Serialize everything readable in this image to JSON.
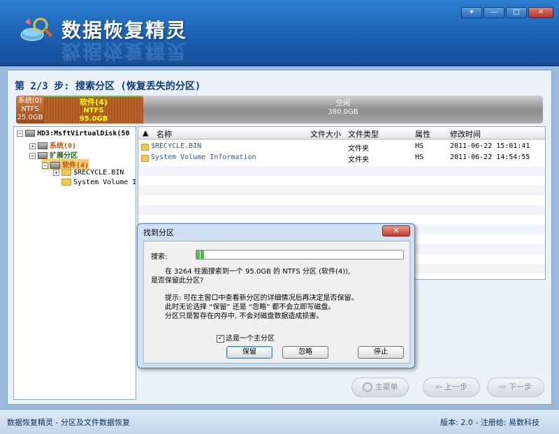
{
  "app": {
    "title": "数据恢复精灵",
    "window_buttons": [
      "▾",
      "—",
      "□",
      "✕"
    ]
  },
  "step": {
    "text": "第 2/3 步: 搜索分区 (恢复丢失的分区)"
  },
  "partition_bar": {
    "system": {
      "name": "系统(0)",
      "fs": "NTFS",
      "size": "25.0GB"
    },
    "software": {
      "name": "软件(4)",
      "fs": "NTFS",
      "size": "95.0GB"
    },
    "free": {
      "name": "空闲",
      "size": "380.0GB"
    }
  },
  "tree": {
    "disk": "HD3:MsftVirtualDisk(50",
    "system": "系统(0)",
    "extended": "扩展分区",
    "software": "软件(4)",
    "recycle": "$RECYCLE.BIN",
    "svi": "System Volume In"
  },
  "file_list": {
    "columns": [
      "名称",
      "文件大小",
      "文件类型",
      "属性",
      "修改时间"
    ],
    "rows": [
      {
        "name": "$RECYCLE.BIN",
        "size": "",
        "type": "文件夹",
        "attr": "HS",
        "modified": "2011-06-22 15:01:41"
      },
      {
        "name": "System Volume Information",
        "size": "",
        "type": "文件夹",
        "attr": "HS",
        "modified": "2011-06-22 14:54:55"
      }
    ]
  },
  "dialog": {
    "title": "找到分区",
    "close": "✕",
    "search_label": "搜索:",
    "progress": 0.04,
    "message1": "在 3264 柱面搜索到一个 95.0GB 的 NTFS 分区 (软件(4)),",
    "message2": "是否保留此分区?",
    "hint1": "提示: 可在主窗口中查看新分区的详细情况后再决定是否保留。",
    "hint2": "此时无论选择 “保留” 还是 “忽略” 都不会立即写磁盘。",
    "hint3": "分区只是暂存在内存中, 不会对磁盘数据造成损害。",
    "checkbox_label": "这是一个主分区",
    "checkbox_checked": true,
    "keep": "保留",
    "ignore": "忽略",
    "stop": "停止"
  },
  "nav": {
    "main_menu": "主菜单",
    "prev": "上一步",
    "next": "下一步"
  },
  "status": {
    "left": "数据恢复精灵 - 分区及文件数据恢复",
    "right": "版本: 2.0 - 注册给: 易数科技"
  }
}
